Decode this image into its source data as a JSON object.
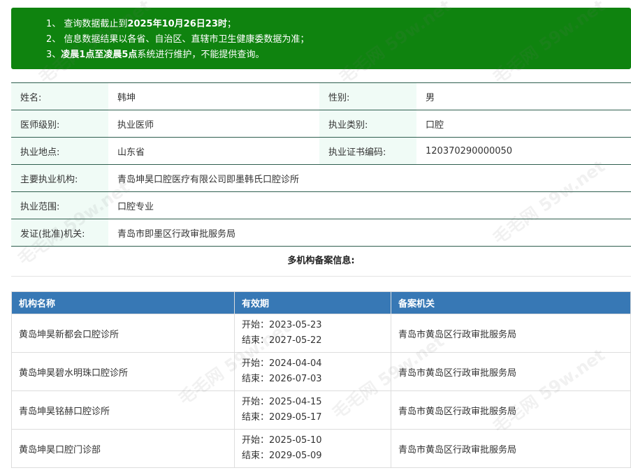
{
  "notice": {
    "line1_prefix": "1、 查询数据截止到",
    "line1_bold": "2025年10月26日23时",
    "line1_suffix": "；",
    "line2": "2、 信息数据结果以各省、自治区、直辖市卫生健康委数据为准；",
    "line3_prefix": "3、",
    "line3_bold": "凌晨1点至凌晨5点",
    "line3_suffix": "系统进行维护，不能提供查询。"
  },
  "info": {
    "name_label": "姓名:",
    "name_value": "韩坤",
    "gender_label": "性别:",
    "gender_value": "男",
    "level_label": "医师级别:",
    "level_value": "执业医师",
    "category_label": "执业类别:",
    "category_value": "口腔",
    "location_label": "执业地点:",
    "location_value": "山东省",
    "cert_label": "执业证书编码:",
    "cert_value": "120370290000050",
    "institution_label": "主要执业机构:",
    "institution_value": "青岛坤昊口腔医疗有限公司即墨韩氏口腔诊所",
    "scope_label": "执业范围:",
    "scope_value": "口腔专业",
    "issuer_label": "发证(批准)机关:",
    "issuer_value": "青岛市即墨区行政审批服务局"
  },
  "multi_title": "多机构备案信息:",
  "registry": {
    "headers": [
      "机构名称",
      "有效期",
      "备案机关"
    ],
    "rows": [
      {
        "name": "黄岛坤昊新都会口腔诊所",
        "start": "开始：2023-05-23",
        "end": "结束：2027-05-22",
        "authority": "青岛市黄岛区行政审批服务局"
      },
      {
        "name": "黄岛坤昊碧水明珠口腔诊所",
        "start": "开始：2024-04-04",
        "end": "结束：2026-07-03",
        "authority": "青岛市黄岛区行政审批服务局"
      },
      {
        "name": "青岛坤昊铭赫口腔诊所",
        "start": "开始：2025-04-15",
        "end": "结束：2029-05-17",
        "authority": "青岛市黄岛区行政审批服务局"
      },
      {
        "name": "黄岛坤昊口腔门诊部",
        "start": "开始：2025-05-10",
        "end": "结束：2029-05-09",
        "authority": "青岛市黄岛区行政审批服务局"
      }
    ]
  },
  "watermark": "毛毛网 59w.net",
  "colors": {
    "notice_bg": "#0f830f",
    "label_bg": "#f0fbf6",
    "table_header_bg": "#3778b5"
  }
}
